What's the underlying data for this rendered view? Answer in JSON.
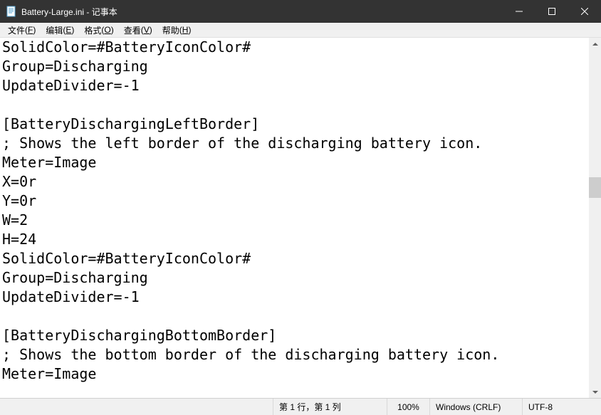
{
  "titlebar": {
    "title": "Battery-Large.ini - 记事本"
  },
  "menubar": {
    "items": [
      {
        "label": "文件",
        "accel": "F"
      },
      {
        "label": "编辑",
        "accel": "E"
      },
      {
        "label": "格式",
        "accel": "O"
      },
      {
        "label": "查看",
        "accel": "V"
      },
      {
        "label": "帮助",
        "accel": "H"
      }
    ]
  },
  "editor": {
    "content": "SolidColor=#BatteryIconColor#\nGroup=Discharging\nUpdateDivider=-1\n\n[BatteryDischargingLeftBorder]\n; Shows the left border of the discharging battery icon.\nMeter=Image\nX=0r\nY=0r\nW=2\nH=24\nSolidColor=#BatteryIconColor#\nGroup=Discharging\nUpdateDivider=-1\n\n[BatteryDischargingBottomBorder]\n; Shows the bottom border of the discharging battery icon.\nMeter=Image"
  },
  "scrollbar": {
    "thumb_top_pct": 38,
    "thumb_height_pct": 6
  },
  "statusbar": {
    "position": "第 1 行，第 1 列",
    "zoom": "100%",
    "line_ending": "Windows (CRLF)",
    "encoding": "UTF-8"
  }
}
